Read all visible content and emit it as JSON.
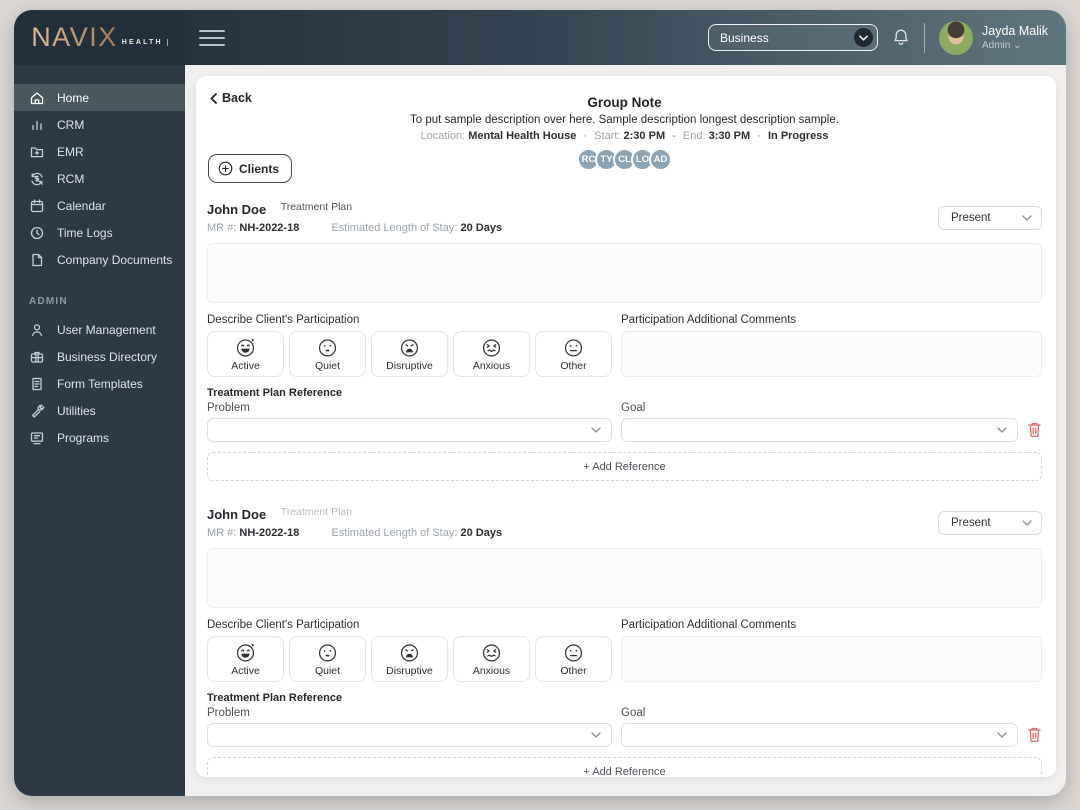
{
  "colors": {
    "sidebar_dark": "#2d3a46",
    "logo_area": "#232f3a",
    "active_item": "#49575f",
    "topbar_gradient_end": "#60767f",
    "main_background": "#f1efee",
    "outer_frame": "#dcd8d5",
    "avatar_circle": "#8ba3b4",
    "logo_tan": "#c9a27f",
    "danger_red": "#dd6b63"
  },
  "brand": {
    "name": "NAVIX",
    "suffix": "HEALTH"
  },
  "topbar": {
    "business_selector": "Business",
    "user_name": "Jayda Malik",
    "user_role": "Admin"
  },
  "sidebar": {
    "items": [
      {
        "label": "Home",
        "icon": "home",
        "active": true
      },
      {
        "label": "CRM",
        "icon": "bar-chart",
        "active": false
      },
      {
        "label": "EMR",
        "icon": "folder-plus",
        "active": false
      },
      {
        "label": "RCM",
        "icon": "refresh-dollar",
        "active": false
      },
      {
        "label": "Calendar",
        "icon": "calendar",
        "active": false
      },
      {
        "label": "Time Logs",
        "icon": "clock",
        "active": false
      },
      {
        "label": "Company Documents",
        "icon": "document",
        "active": false
      }
    ],
    "admin_heading": "ADMIN",
    "admin_items": [
      {
        "label": "User Management",
        "icon": "user"
      },
      {
        "label": "Business Directory",
        "icon": "briefcase"
      },
      {
        "label": "Form Templates",
        "icon": "form"
      },
      {
        "label": "Utilities",
        "icon": "wrench"
      },
      {
        "label": "Programs",
        "icon": "monitor"
      }
    ]
  },
  "note": {
    "back_label": "Back",
    "title": "Group Note",
    "description": "To put sample description over here. Sample description longest description sample.",
    "location_label": "Location:",
    "location": "Mental Health House",
    "dot_separator": "·",
    "start_label": "Start:",
    "start_time": "2:30 PM",
    "dash_separator": "-",
    "end_label": "End:",
    "end_time": "3:30 PM",
    "status": "In Progress",
    "attendee_initials": [
      "RC",
      "TY",
      "CL",
      "LO",
      "AD"
    ],
    "clients_button_label": "Clients"
  },
  "section_labels": {
    "plan_tag": "Treatment Plan",
    "mr_label": "MR #:",
    "los_label": "Estimated Length of Stay:",
    "participation_label": "Describe Client's Participation",
    "comments_label": "Participation Additional Comments",
    "reference_heading": "Treatment Plan Reference",
    "problem_label": "Problem",
    "goal_label": "Goal",
    "add_reference_label": "+ Add Reference"
  },
  "participation_options": [
    "Active",
    "Quiet",
    "Disruptive",
    "Anxious",
    "Other"
  ],
  "clients": [
    {
      "name": "John Doe",
      "mr_number": "NH-2022-18",
      "length_of_stay": "20 Days",
      "attendance": "Present"
    },
    {
      "name": "John Doe",
      "mr_number": "NH-2022-18",
      "length_of_stay": "20 Days",
      "attendance": "Present"
    }
  ]
}
